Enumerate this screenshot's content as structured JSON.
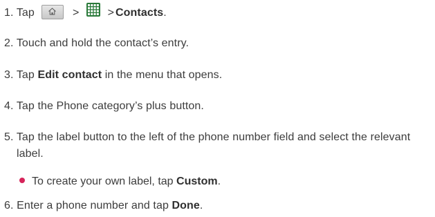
{
  "steps": [
    {
      "num": "1.",
      "pre": "Tap",
      "sep1": ">",
      "sep2": ">",
      "bold": "Contacts",
      "post": "."
    },
    {
      "num": "2.",
      "text": "Touch and hold the contact’s entry."
    },
    {
      "num": "3.",
      "pre": "Tap ",
      "bold": "Edit contact",
      "post": " in the menu that opens."
    },
    {
      "num": "4.",
      "text": "Tap the Phone category’s plus button."
    },
    {
      "num": "5.",
      "text": "Tap the label button to the left of the phone number field and select the relevant label."
    },
    {
      "num": "6.",
      "pre": "Enter a phone number and tap ",
      "bold": "Done",
      "post": "."
    }
  ],
  "bullet": {
    "pre": "To create your own label, tap ",
    "bold": "Custom",
    "post": "."
  },
  "icons": {
    "home_key": "home-icon",
    "apps": "apps-grid-icon"
  },
  "colors": {
    "bullet": "#d6245a",
    "apps_icon": "#2a7a3a"
  }
}
